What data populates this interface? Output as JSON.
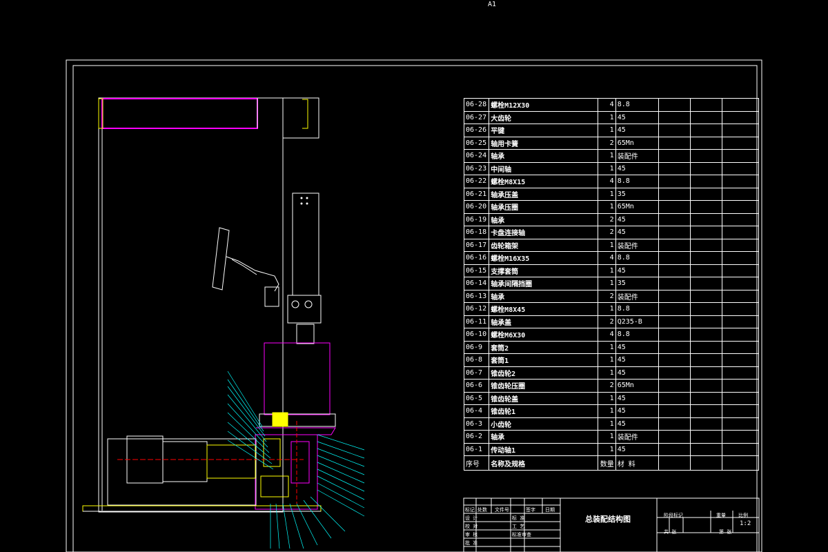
{
  "sheet": {
    "size_label": "A1"
  },
  "colors": {
    "line": "#ffffff",
    "frame": "#ffffff",
    "accent_yellow": "#ffff00",
    "accent_magenta": "#ff00ff",
    "accent_cyan": "#00ffff",
    "accent_green": "#00ff00",
    "accent_red": "#ff0000"
  },
  "bom": {
    "rows": [
      {
        "code": "06-28",
        "name": "螺栓M12X30",
        "qty": "4",
        "material": "8.8"
      },
      {
        "code": "06-27",
        "name": "大齿轮",
        "qty": "1",
        "material": "45"
      },
      {
        "code": "06-26",
        "name": "平键",
        "qty": "1",
        "material": "45"
      },
      {
        "code": "06-25",
        "name": "轴用卡簧",
        "qty": "2",
        "material": "65Mn"
      },
      {
        "code": "06-24",
        "name": "轴承",
        "qty": "1",
        "material": "装配件"
      },
      {
        "code": "06-23",
        "name": "中间轴",
        "qty": "1",
        "material": "45"
      },
      {
        "code": "06-22",
        "name": "螺栓M8X15",
        "qty": "4",
        "material": "8.8"
      },
      {
        "code": "06-21",
        "name": "轴承压盖",
        "qty": "1",
        "material": "35"
      },
      {
        "code": "06-20",
        "name": "轴承压圈",
        "qty": "1",
        "material": "65Mn"
      },
      {
        "code": "06-19",
        "name": "轴承",
        "qty": "2",
        "material": "45"
      },
      {
        "code": "06-18",
        "name": "卡盘连接轴",
        "qty": "2",
        "material": "45"
      },
      {
        "code": "06-17",
        "name": "齿轮箱架",
        "qty": "1",
        "material": "装配件"
      },
      {
        "code": "06-16",
        "name": "螺栓M16X35",
        "qty": "4",
        "material": "8.8"
      },
      {
        "code": "06-15",
        "name": "支撑套筒",
        "qty": "1",
        "material": "45"
      },
      {
        "code": "06-14",
        "name": "轴承间隔挡圈",
        "qty": "1",
        "material": "35"
      },
      {
        "code": "06-13",
        "name": "轴承",
        "qty": "2",
        "material": "装配件"
      },
      {
        "code": "06-12",
        "name": "螺栓M8X45",
        "qty": "1",
        "material": "8.8"
      },
      {
        "code": "06-11",
        "name": "轴承盖",
        "qty": "2",
        "material": "Q235-B"
      },
      {
        "code": "06-10",
        "name": "螺栓M6X30",
        "qty": "4",
        "material": "8.8"
      },
      {
        "code": "06-9",
        "name": "套筒2",
        "qty": "1",
        "material": "45"
      },
      {
        "code": "06-8",
        "name": "套筒1",
        "qty": "1",
        "material": "45"
      },
      {
        "code": "06-7",
        "name": "锥齿轮2",
        "qty": "1",
        "material": "45"
      },
      {
        "code": "06-6",
        "name": "锥齿轮压圈",
        "qty": "2",
        "material": "65Mn"
      },
      {
        "code": "06-5",
        "name": "锥齿轮盖",
        "qty": "1",
        "material": "45"
      },
      {
        "code": "06-4",
        "name": "锥齿轮1",
        "qty": "1",
        "material": "45"
      },
      {
        "code": "06-3",
        "name": "小齿轮",
        "qty": "1",
        "material": "45"
      },
      {
        "code": "06-2",
        "name": "轴承",
        "qty": "1",
        "material": "装配件"
      },
      {
        "code": "06-1",
        "name": "传动轴1",
        "qty": "1",
        "material": "45"
      }
    ],
    "header": {
      "code": "序号",
      "name": "名称及规格",
      "qty": "数量",
      "material": "材 料"
    }
  },
  "title_block": {
    "drawing_title": "总装配结构图",
    "scale": "1:2",
    "labels": {
      "mark": "标记",
      "count": "处数",
      "doc_no": "文件号",
      "sign": "签字",
      "date": "日期",
      "design": "设 计",
      "standard": "标 准",
      "stage_mark": "阶段标记",
      "weight": "重量",
      "ratio": "比例",
      "proofread": "校 对",
      "process": "工 艺",
      "approve": "审 核",
      "std_check": "标准审查",
      "approve2": "批 准",
      "sheet_total": "共 张",
      "sheet_no": "第 张"
    }
  }
}
